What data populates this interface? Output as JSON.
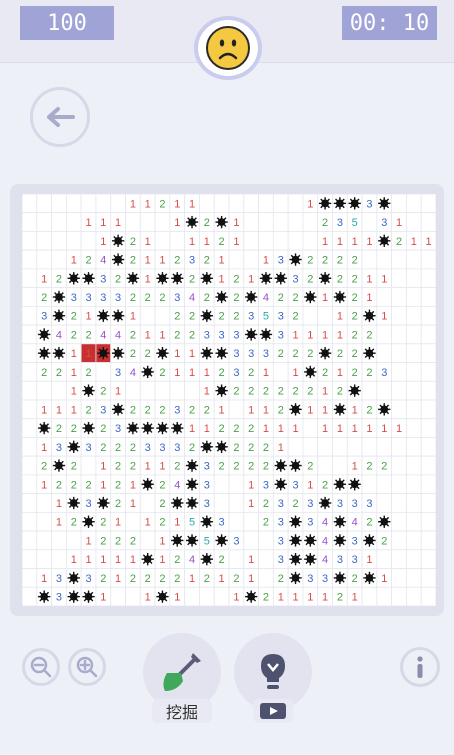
{
  "header": {
    "mine_counter": "100",
    "timer": "00: 10",
    "face_state": "sad"
  },
  "colors": {
    "n1": "#d84b4b",
    "n2": "#4aa04a",
    "n3": "#3b68c8",
    "n4": "#9b4fd1",
    "n5": "#2ba7b0",
    "mine": "#111111",
    "exploded": "#c83030",
    "accent": "#9fa3d6"
  },
  "board": {
    "rows": [
      "       11211       1***3*",
      "    111   1*2*1     235 31",
      "     1*21  1121     1111*211",
      "   124*2112321  13*2222",
      " 12**32*1**2*121**32*2211",
      " 2*3333222342*2*422*1*21",
      " 3*21**1  22*223532  12*1",
      " *4224421122333**3111122",
      " **11x*22*11**333222*22*",
      " 2212 34*21112321 1*21223",
      "   1*21     1*22222212*",
      " 11123*2223221 112*11*12*",
      " *22*23****11222111 111111",
      " 13*32223332**2221",
      " 2*2 122112*32222**2  122",
      " 1222121*24*3  13*312**",
      "  1*3*21 2**3  12323*333",
      "  12*21 1215*3  23*34*42*",
      "    1222 1**5*3  3**4*3*2",
      "   11111*124*2 1 3**4331",
      " 13*321222212121 2*33*2*1",
      " *3**1  1*1   1*2111121"
    ],
    "exploded_cell": [
      8,
      4
    ]
  },
  "controls": {
    "dig_label": "挖掘"
  },
  "icons": {
    "back": "arrow-left-icon",
    "zoom_out": "zoom-out-icon",
    "zoom_in": "zoom-in-icon",
    "dig": "shovel-icon",
    "hint": "lightbulb-icon",
    "video": "video-play-icon",
    "info": "info-icon"
  }
}
